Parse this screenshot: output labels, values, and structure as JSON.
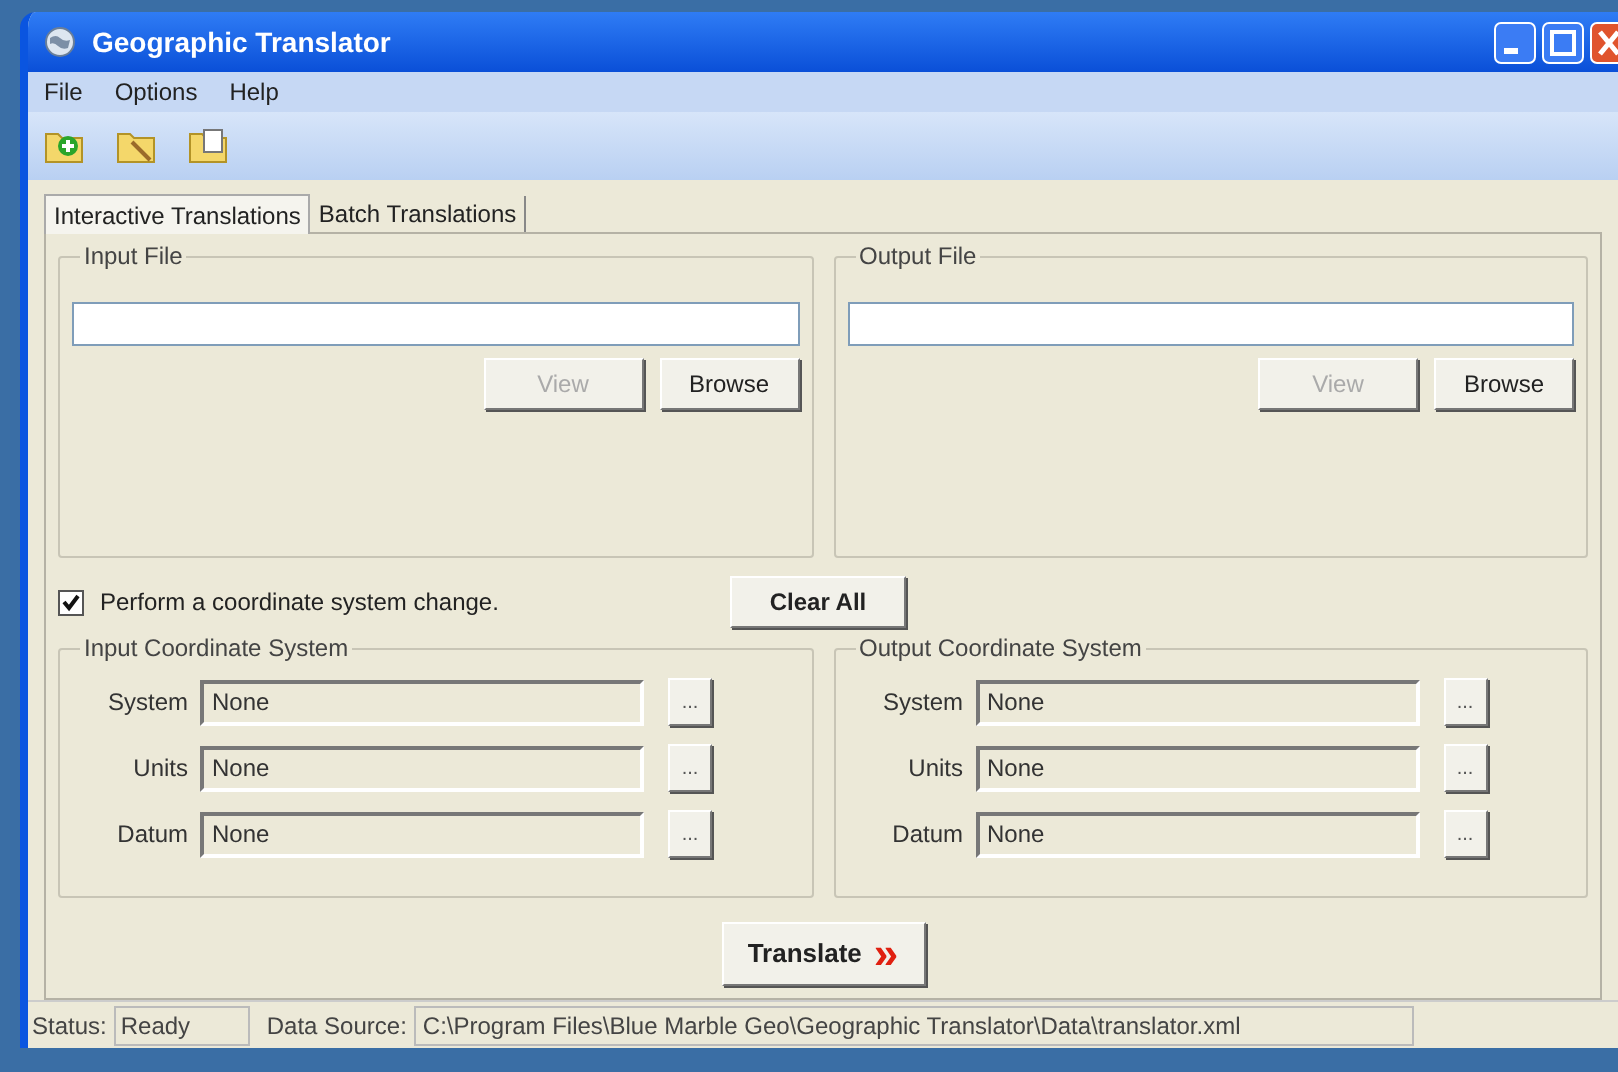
{
  "window": {
    "title": "Geographic Translator"
  },
  "menu": [
    "File",
    "Options",
    "Help"
  ],
  "tabs": [
    {
      "label": "Interactive Translations",
      "selected": true
    },
    {
      "label": "Batch Translations",
      "selected": false
    }
  ],
  "file_groups": [
    {
      "title": "Input File",
      "view": "View",
      "view_disabled": true,
      "browse": "Browse"
    },
    {
      "title": "Output File",
      "view": "View",
      "view_disabled": true,
      "browse": "Browse"
    }
  ],
  "coordinate_change": {
    "label": "Perform a coordinate system change.",
    "checked": true
  },
  "clear_all": "Clear All",
  "coordinate_groups": [
    {
      "title": "Input Coordinate System",
      "rows": [
        {
          "label": "System",
          "value": "None",
          "button": "..."
        },
        {
          "label": "Units",
          "value": "None",
          "button": "..."
        },
        {
          "label": "Datum",
          "value": "None",
          "button": "..."
        }
      ]
    },
    {
      "title": "Output Coordinate System",
      "rows": [
        {
          "label": "System",
          "value": "None",
          "button": "..."
        },
        {
          "label": "Units",
          "value": "None",
          "button": "..."
        },
        {
          "label": "Datum",
          "value": "None",
          "button": "..."
        }
      ]
    }
  ],
  "translate_button": {
    "label": "Translate",
    "arrows": "»"
  },
  "status_bar": {
    "status_label": "Status:",
    "status": "Ready",
    "source_label": "Data Source:",
    "source": "C:\\Program Files\\Blue Marble Geo\\Geographic Translator\\Data\\translator.xml"
  }
}
